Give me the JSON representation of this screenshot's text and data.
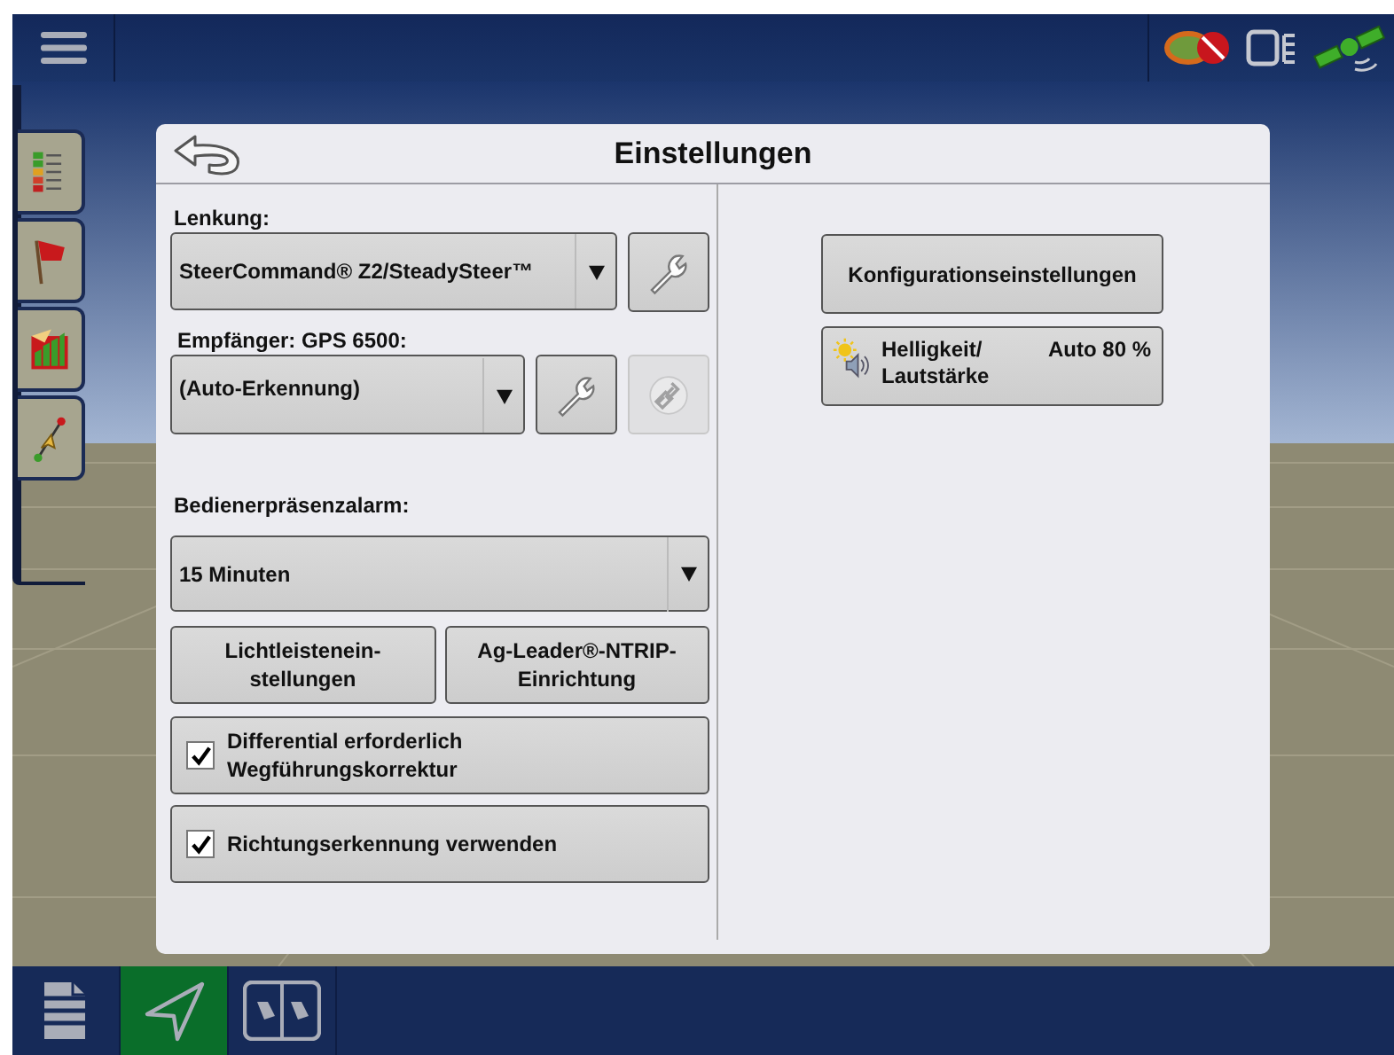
{
  "side_tabs": [
    {
      "kind": "gauge"
    },
    {
      "kind": "flag"
    },
    {
      "kind": "chart"
    },
    {
      "kind": "path"
    }
  ],
  "dialog": {
    "title": "Einstellungen",
    "steering": {
      "label": "Lenkung:",
      "value": "SteerCommand® Z2/SteadySteer™"
    },
    "receiver": {
      "label": "Empfänger: GPS 6500:",
      "value": "(Auto-Erkennung)",
      "link_disabled": true
    },
    "operator_alarm": {
      "label": "Bedienerpräsenzalarm:",
      "value": "15 Minuten"
    },
    "buttons": [
      "Lichtleistenein-\nstellungen",
      "Ag-Leader®-NTRIP-\nEinrichtung"
    ],
    "checkboxes": [
      {
        "label": "Differential erforderlich\nWegführungskorrektur",
        "checked": true
      },
      {
        "label": "Richtungserkennung verwenden",
        "checked": true
      }
    ],
    "config_button": "Konfigurationseinstellungen",
    "brightness": {
      "label": "Helligkeit/\nLautstärke",
      "value": "Auto 80 %"
    }
  },
  "bottom_tabs": [
    {
      "kind": "document",
      "selected": false
    },
    {
      "kind": "navigation",
      "selected": true
    },
    {
      "kind": "split",
      "selected": false
    }
  ]
}
